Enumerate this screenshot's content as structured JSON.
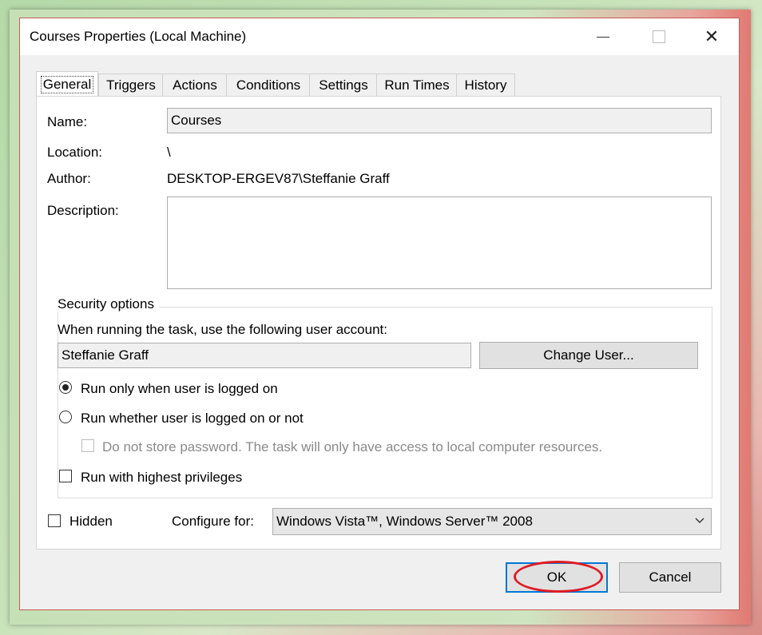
{
  "window": {
    "title": "Courses Properties (Local Machine)"
  },
  "tabs": [
    {
      "label": "General",
      "active": true
    },
    {
      "label": "Triggers"
    },
    {
      "label": "Actions"
    },
    {
      "label": "Conditions"
    },
    {
      "label": "Settings"
    },
    {
      "label": "Run Times"
    },
    {
      "label": "History"
    }
  ],
  "general": {
    "name_label": "Name:",
    "name_value": "Courses",
    "location_label": "Location:",
    "location_value": "\\",
    "author_label": "Author:",
    "author_value": "DESKTOP-ERGEV87\\Steffanie Graff",
    "description_label": "Description:",
    "description_value": ""
  },
  "security": {
    "legend": "Security options",
    "account_prompt": "When running the task, use the following user account:",
    "account_value": "Steffanie Graff",
    "change_user_label": "Change User...",
    "radio_logged_on": "Run only when user is logged on",
    "radio_logged_on_checked": true,
    "radio_whether": "Run whether user is logged on or not",
    "no_store_password": "Do not store password. The task will only have access to local computer resources.",
    "highest_privileges": "Run with highest privileges"
  },
  "footer": {
    "hidden_label": "Hidden",
    "configure_label": "Configure for:",
    "configure_value": "Windows Vista™, Windows Server™ 2008"
  },
  "buttons": {
    "ok": "OK",
    "cancel": "Cancel"
  },
  "colors": {
    "accent": "#0078d7",
    "highlight_circle": "#e01b24"
  }
}
